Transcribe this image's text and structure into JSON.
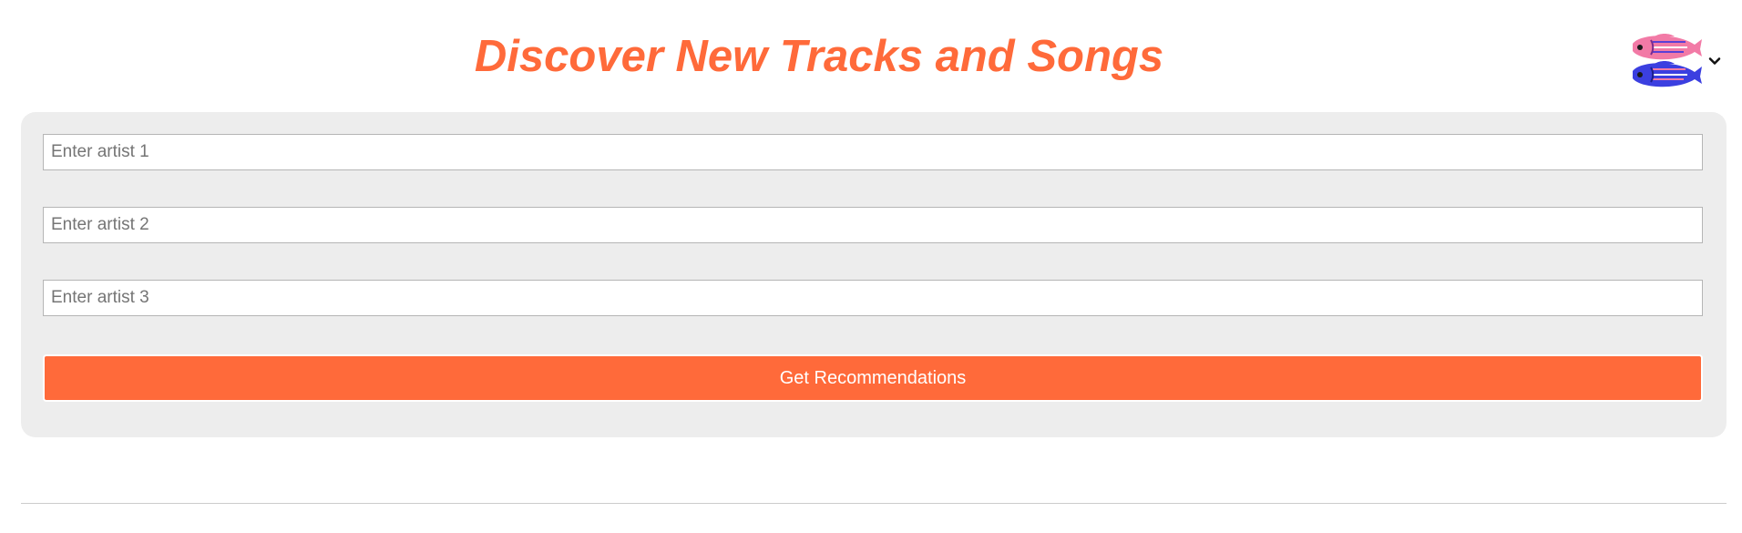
{
  "header": {
    "title": "Discover New Tracks and Songs"
  },
  "language_switcher": {
    "flag_icon": "fish-flag-icon",
    "chevron_icon": "chevron-down-icon"
  },
  "form": {
    "artist_inputs": [
      {
        "value": "",
        "placeholder": "Enter artist 1"
      },
      {
        "value": "",
        "placeholder": "Enter artist 2"
      },
      {
        "value": "",
        "placeholder": "Enter artist 3"
      }
    ],
    "submit_label": "Get Recommendations"
  },
  "colors": {
    "accent": "#ff6a3a",
    "panel_background": "#ededed",
    "input_border": "#b5b5b5",
    "divider": "#cccccc"
  }
}
